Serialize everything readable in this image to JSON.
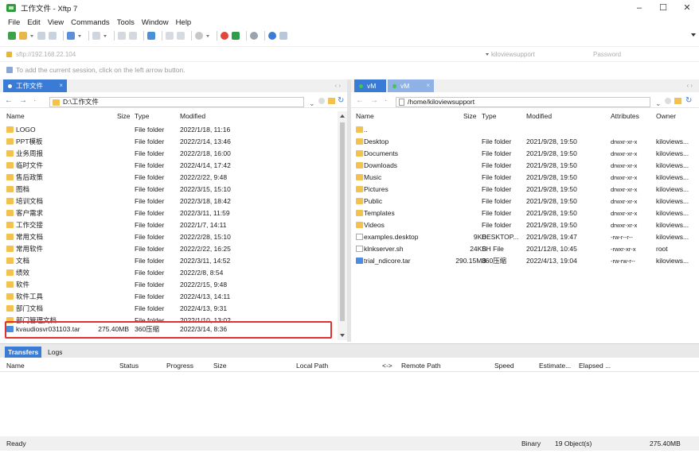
{
  "window": {
    "title": "工作文件 - Xftp 7",
    "minimize": "–",
    "maximize": "☐",
    "close": "✕"
  },
  "menu": [
    "File",
    "Edit",
    "View",
    "Commands",
    "Tools",
    "Window",
    "Help"
  ],
  "address": {
    "url": "sftp://192.168.22.104",
    "username": "kiloviewsupport",
    "password_placeholder": "Password"
  },
  "hint": "To add the current session, click on the left arrow button.",
  "left_tab": {
    "label": "工作文件",
    "close": "×",
    "arrows": "‹ ›"
  },
  "right_tabs": [
    {
      "label": "vM",
      "active": true
    },
    {
      "label": "vM",
      "active": false,
      "close": "×"
    }
  ],
  "right_tab_arrows": "‹ ›",
  "left_path": "D:\\工作文件",
  "right_path": "/home/kiloviewsupport",
  "left_columns": {
    "name": "Name",
    "size": "Size",
    "type": "Type",
    "modified": "Modified"
  },
  "right_columns": {
    "name": "Name",
    "size": "Size",
    "type": "Type",
    "modified": "Modified",
    "attributes": "Attributes",
    "owner": "Owner"
  },
  "left_files": [
    {
      "name": "LOGO",
      "size": "",
      "type": "File folder",
      "modified": "2022/1/18, 11:16",
      "icon": "folder"
    },
    {
      "name": "PPT模板",
      "size": "",
      "type": "File folder",
      "modified": "2022/2/14, 13:46",
      "icon": "folder"
    },
    {
      "name": "业务周报",
      "size": "",
      "type": "File folder",
      "modified": "2022/2/18, 16:00",
      "icon": "folder"
    },
    {
      "name": "临时文件",
      "size": "",
      "type": "File folder",
      "modified": "2022/4/14, 17:42",
      "icon": "folder"
    },
    {
      "name": "售后政策",
      "size": "",
      "type": "File folder",
      "modified": "2022/2/22, 9:48",
      "icon": "folder"
    },
    {
      "name": "图档",
      "size": "",
      "type": "File folder",
      "modified": "2022/3/15, 15:10",
      "icon": "folder"
    },
    {
      "name": "培训文档",
      "size": "",
      "type": "File folder",
      "modified": "2022/3/18, 18:42",
      "icon": "folder"
    },
    {
      "name": "客户需求",
      "size": "",
      "type": "File folder",
      "modified": "2022/3/11, 11:59",
      "icon": "folder"
    },
    {
      "name": "工作交接",
      "size": "",
      "type": "File folder",
      "modified": "2022/1/7, 14:11",
      "icon": "folder"
    },
    {
      "name": "常用文档",
      "size": "",
      "type": "File folder",
      "modified": "2022/2/28, 15:10",
      "icon": "folder"
    },
    {
      "name": "常用软件",
      "size": "",
      "type": "File folder",
      "modified": "2022/2/22, 16:25",
      "icon": "folder"
    },
    {
      "name": "文档",
      "size": "",
      "type": "File folder",
      "modified": "2022/3/11, 14:52",
      "icon": "folder"
    },
    {
      "name": "绩效",
      "size": "",
      "type": "File folder",
      "modified": "2022/2/8, 8:54",
      "icon": "folder"
    },
    {
      "name": "软件",
      "size": "",
      "type": "File folder",
      "modified": "2022/2/15, 9:48",
      "icon": "folder"
    },
    {
      "name": "软件工具",
      "size": "",
      "type": "File folder",
      "modified": "2022/4/13, 14:11",
      "icon": "folder"
    },
    {
      "name": "部门文档",
      "size": "",
      "type": "File folder",
      "modified": "2022/4/13, 9:31",
      "icon": "folder"
    },
    {
      "name": "部门管理文档",
      "size": "",
      "type": "File folder",
      "modified": "2022/1/10, 13:02",
      "icon": "folder"
    },
    {
      "name": "kvaudiosvr031103.tar",
      "size": "275.40MB",
      "type": "360压缩",
      "modified": "2022/3/14, 8:36",
      "icon": "tar"
    }
  ],
  "right_files": [
    {
      "name": "..",
      "size": "",
      "type": "",
      "modified": "",
      "attributes": "",
      "owner": "",
      "icon": "folder"
    },
    {
      "name": "Desktop",
      "size": "",
      "type": "File folder",
      "modified": "2021/9/28, 19:50",
      "attributes": "drwxr-xr-x",
      "owner": "kiloviews...",
      "icon": "folder"
    },
    {
      "name": "Documents",
      "size": "",
      "type": "File folder",
      "modified": "2021/9/28, 19:50",
      "attributes": "drwxr-xr-x",
      "owner": "kiloviews...",
      "icon": "folder"
    },
    {
      "name": "Downloads",
      "size": "",
      "type": "File folder",
      "modified": "2021/9/28, 19:50",
      "attributes": "drwxr-xr-x",
      "owner": "kiloviews...",
      "icon": "folder"
    },
    {
      "name": "Music",
      "size": "",
      "type": "File folder",
      "modified": "2021/9/28, 19:50",
      "attributes": "drwxr-xr-x",
      "owner": "kiloviews...",
      "icon": "folder"
    },
    {
      "name": "Pictures",
      "size": "",
      "type": "File folder",
      "modified": "2021/9/28, 19:50",
      "attributes": "drwxr-xr-x",
      "owner": "kiloviews...",
      "icon": "folder"
    },
    {
      "name": "Public",
      "size": "",
      "type": "File folder",
      "modified": "2021/9/28, 19:50",
      "attributes": "drwxr-xr-x",
      "owner": "kiloviews...",
      "icon": "folder"
    },
    {
      "name": "Templates",
      "size": "",
      "type": "File folder",
      "modified": "2021/9/28, 19:50",
      "attributes": "drwxr-xr-x",
      "owner": "kiloviews...",
      "icon": "folder"
    },
    {
      "name": "Videos",
      "size": "",
      "type": "File folder",
      "modified": "2021/9/28, 19:50",
      "attributes": "drwxr-xr-x",
      "owner": "kiloviews...",
      "icon": "folder"
    },
    {
      "name": "examples.desktop",
      "size": "9KB",
      "type": "DESKTOP...",
      "modified": "2021/9/28, 19:47",
      "attributes": "-rw-r--r--",
      "owner": "kiloviews...",
      "icon": "file"
    },
    {
      "name": "klnkserver.sh",
      "size": "24KB",
      "type": "SH File",
      "modified": "2021/12/8, 10:45",
      "attributes": "-rwxr-xr-x",
      "owner": "root",
      "icon": "file"
    },
    {
      "name": "trial_ndicore.tar",
      "size": "290.15MB",
      "type": "360压缩",
      "modified": "2022/4/13, 19:04",
      "attributes": "-rw-rw-r--",
      "owner": "kiloviews...",
      "icon": "tar"
    }
  ],
  "transfer_tabs": {
    "transfers": "Transfers",
    "logs": "Logs"
  },
  "transfer_columns": {
    "name": "Name",
    "status": "Status",
    "progress": "Progress",
    "size": "Size",
    "local_path": "Local Path",
    "direction": "<->",
    "remote_path": "Remote Path",
    "speed": "Speed",
    "estimate": "Estimate...",
    "elapsed": "Elapsed ..."
  },
  "status": {
    "left": "Ready",
    "mode": "Binary",
    "objects": "19 Object(s)",
    "size": "275.40MB"
  },
  "colors": {
    "accent": "#3a7bd5",
    "folder": "#f2c14e",
    "highlight": "#e0312f",
    "green_dot": "#3cc84a"
  }
}
